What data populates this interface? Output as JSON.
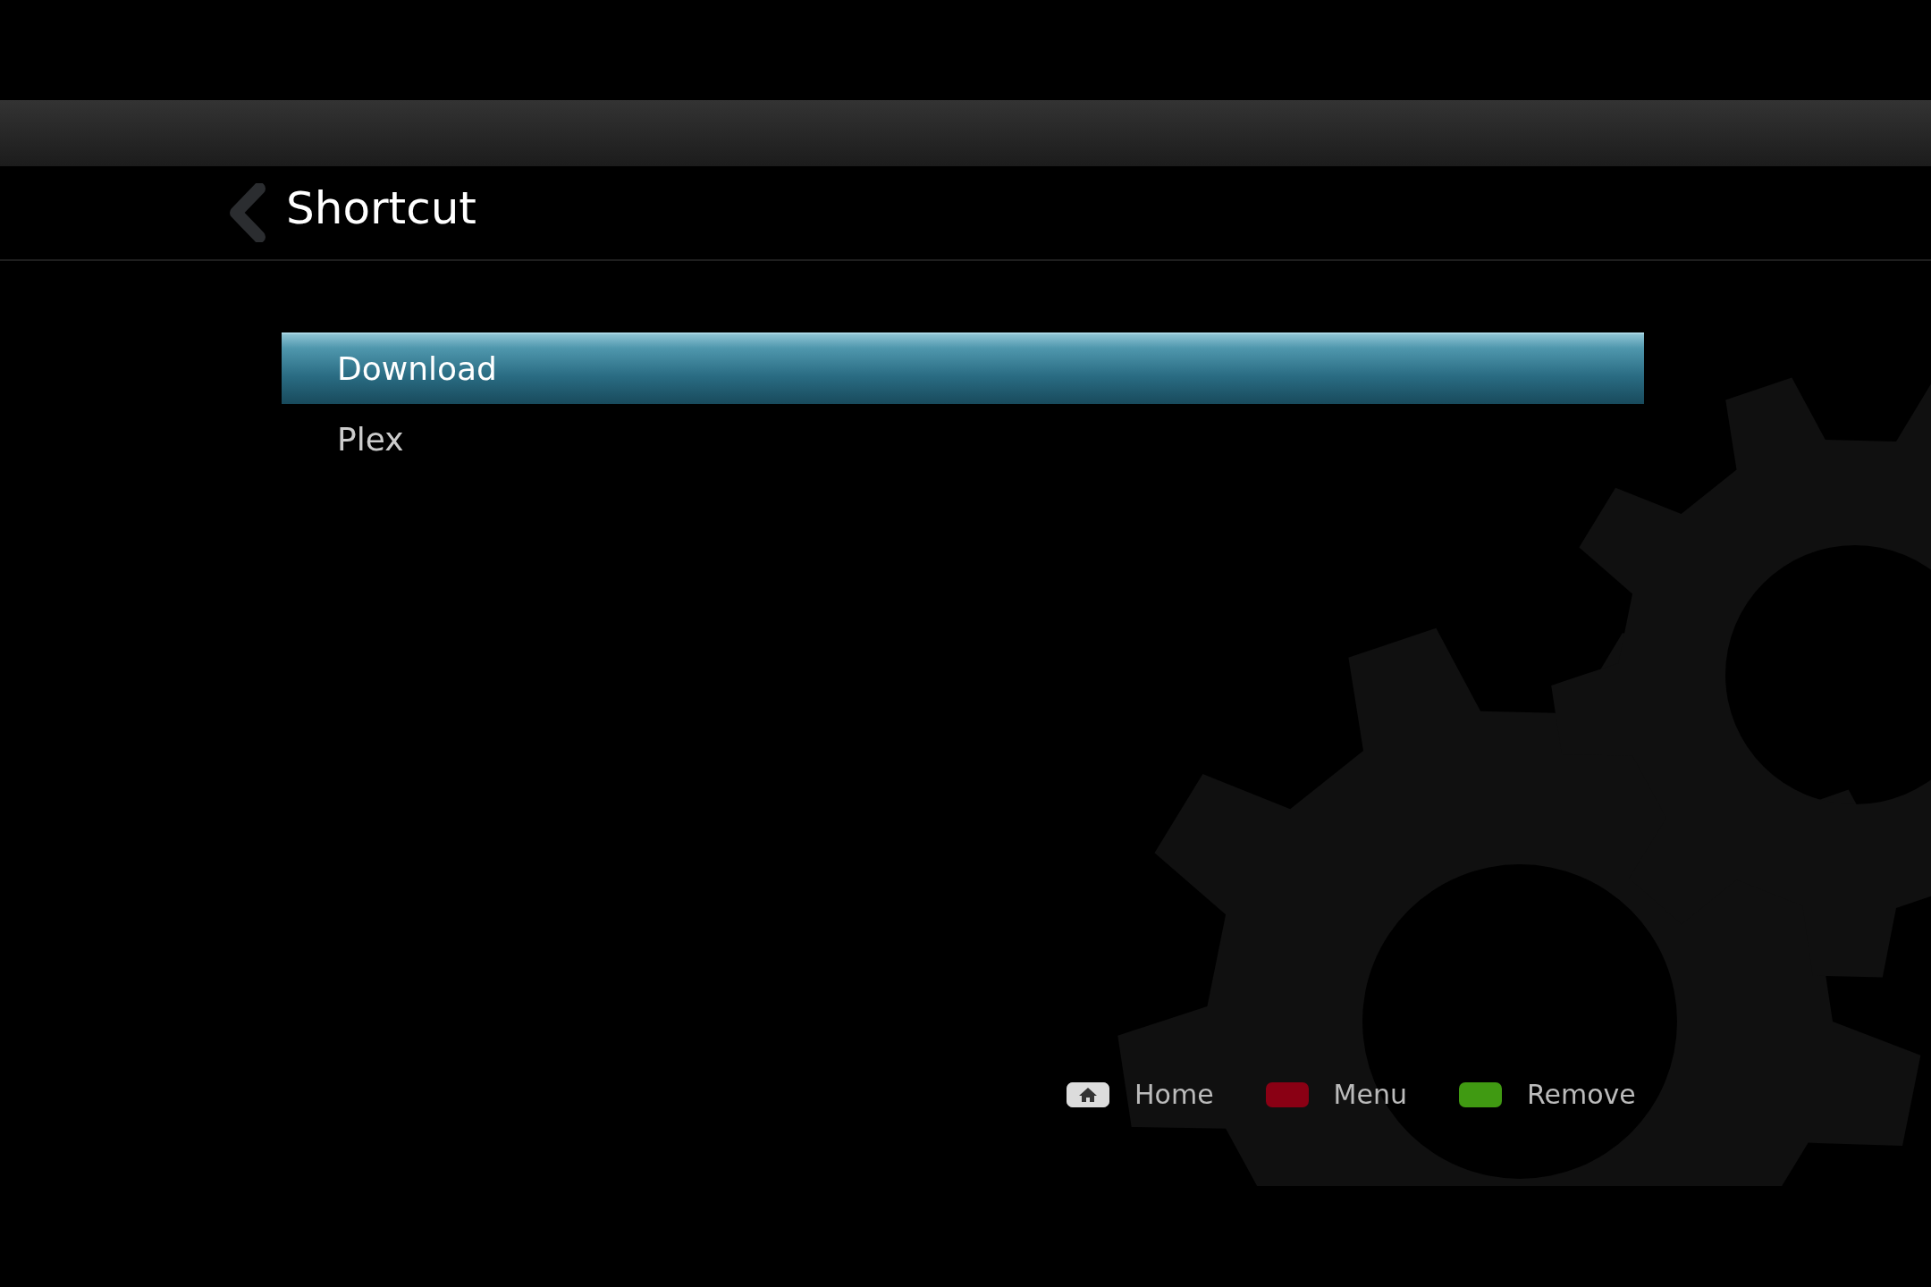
{
  "header": {
    "title": "Shortcut"
  },
  "menu": {
    "items": [
      {
        "label": "Download",
        "selected": true
      },
      {
        "label": "Plex",
        "selected": false
      }
    ]
  },
  "footer": {
    "keys": [
      {
        "kind": "home",
        "label": "Home"
      },
      {
        "kind": "color",
        "color": "#8a0014",
        "label": "Menu"
      },
      {
        "kind": "color",
        "color": "#409a12",
        "label": "Remove"
      }
    ]
  }
}
